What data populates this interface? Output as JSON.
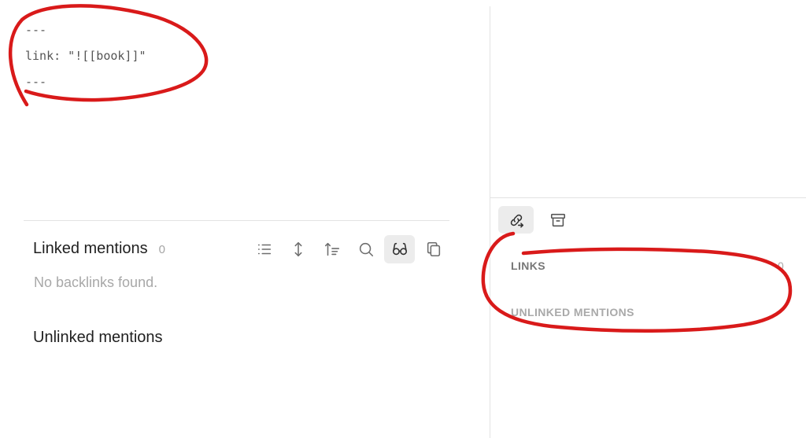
{
  "editor": {
    "frontmatter_lines": [
      "---",
      "link: \"![[book]]\"",
      "---"
    ]
  },
  "backlinks": {
    "linked_title": "Linked mentions",
    "linked_count": "0",
    "empty_text": "No backlinks found.",
    "unlinked_title": "Unlinked mentions",
    "toolbar_icons": [
      "list-icon",
      "expand-vertical-icon",
      "sort-icon",
      "search-icon",
      "glasses-icon",
      "copy-icon"
    ],
    "active_tool": "glasses-icon"
  },
  "right_pane": {
    "tabs": [
      {
        "icon": "outgoing-links-icon",
        "active": true
      },
      {
        "icon": "archive-icon",
        "active": false
      }
    ],
    "links_label": "LINKS",
    "links_count": "0",
    "unlinked_label": "UNLINKED MENTIONS"
  },
  "colors": {
    "annotation": "#d91a1a",
    "active_bg": "#ececec",
    "divider": "#e3e3e3"
  }
}
